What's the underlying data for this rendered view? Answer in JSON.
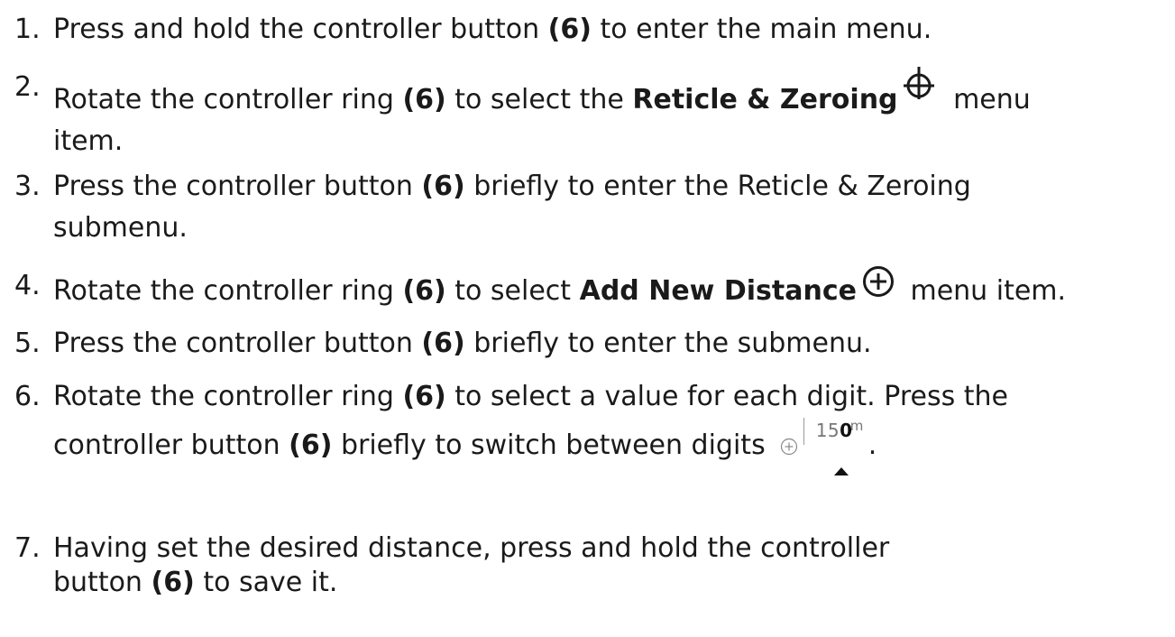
{
  "steps": [
    {
      "number": "1.",
      "text_a": "Press and hold the controller button ",
      "ref": "(6)",
      "text_b": " to enter the main menu."
    },
    {
      "number": "2.",
      "text_a": "Rotate the controller ring ",
      "ref": "(6)",
      "text_b": " to select the ",
      "item": "Reticle & Zeroing",
      "icon": "reticle-icon",
      "text_c": " menu",
      "text_d": "item."
    },
    {
      "number": "3.",
      "text_a": "Press the controller button ",
      "ref": "(6)",
      "text_b": " briefly to enter the Reticle & Zeroing",
      "text_c": "submenu."
    },
    {
      "number": "4.",
      "text_a": "Rotate the controller ring ",
      "ref": "(6)",
      "text_b": " to select ",
      "item": "Add New Distance",
      "icon": "plus-circle-icon",
      "text_c": " menu item."
    },
    {
      "number": "5.",
      "text_a": "Press the controller button ",
      "ref": "(6)",
      "text_b": " briefly to enter the submenu."
    },
    {
      "number": "6.",
      "text_a": "Rotate the controller ring ",
      "ref": "(6)",
      "text_b": " to select a value for each digit. Press the",
      "text_c": "controller button ",
      "ref2": "(6)",
      "text_d": " briefly to switch between digits",
      "widget": {
        "value_prefix": "15",
        "value_current": "0",
        "unit": "m",
        "icon": "plus-circle-icon"
      },
      "text_e": "."
    },
    {
      "number": "7.",
      "text_a": "Having set the desired distance, press and hold the controller",
      "text_b": "button ",
      "ref": "(6)",
      "text_c": " to save it."
    }
  ],
  "colors": {
    "text": "#1a1a1a",
    "widget_muted": "#777777"
  }
}
